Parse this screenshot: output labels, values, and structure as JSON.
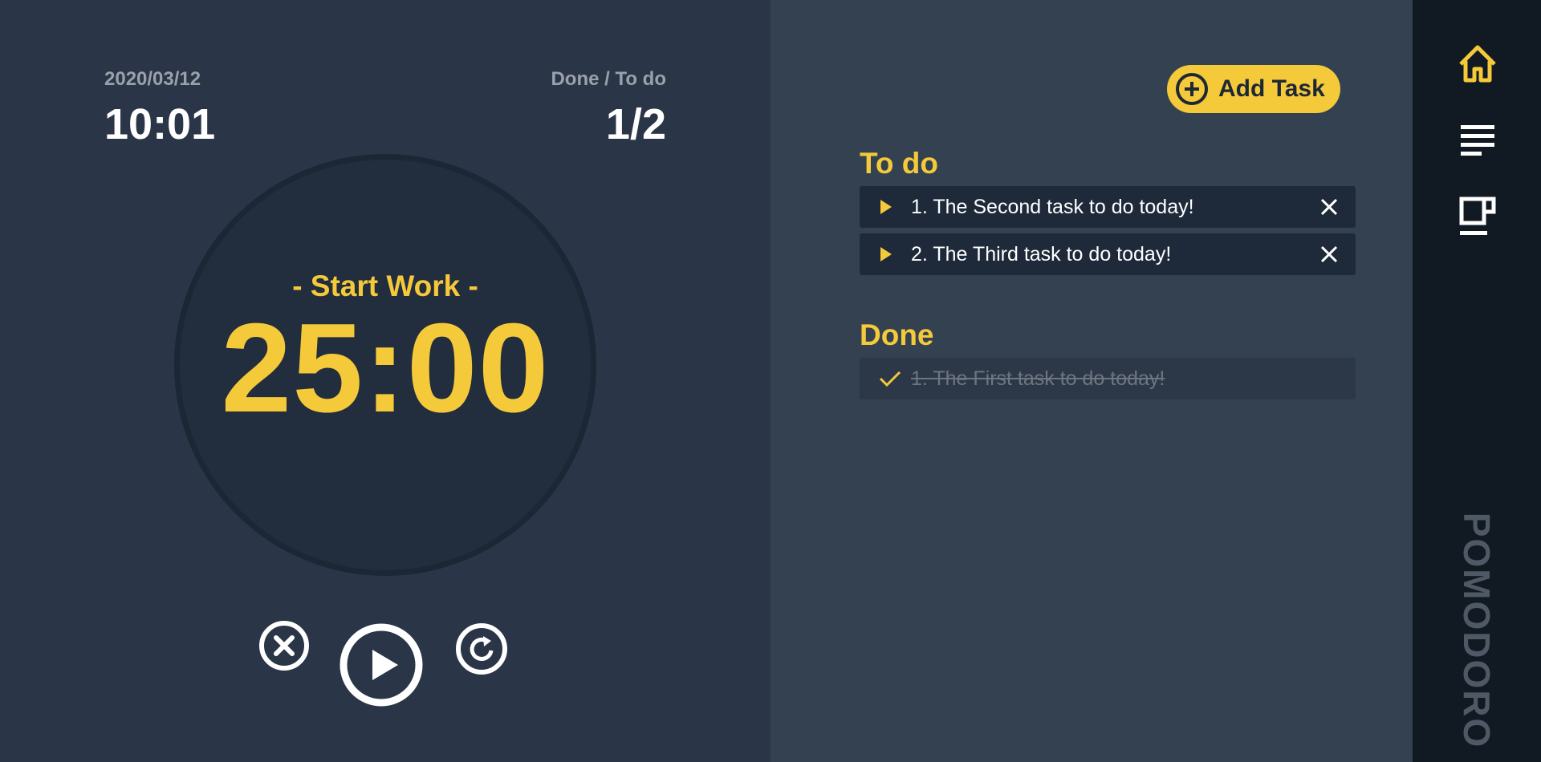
{
  "clock": {
    "date": "2020/03/12",
    "time": "10:01"
  },
  "progress": {
    "label": "Done / To do",
    "count": "1/2"
  },
  "timer": {
    "mode": "- Start Work -",
    "countdown": "25:00"
  },
  "controls": {
    "cancel_icon": "close-circle-icon",
    "play_icon": "play-circle-icon",
    "reset_icon": "refresh-circle-icon"
  },
  "tasks": {
    "add_label": "Add Task",
    "todo_title": "To do",
    "done_title": "Done",
    "todo": [
      {
        "text": "1. The Second task to do today!"
      },
      {
        "text": "2. The Third task to do today!"
      }
    ],
    "done": [
      {
        "text": "1. The First task to do today!"
      }
    ]
  },
  "sidebar": {
    "items": [
      {
        "icon": "home-icon",
        "active": true
      },
      {
        "icon": "list-icon",
        "active": false
      },
      {
        "icon": "coffee-icon",
        "active": false
      }
    ],
    "brand": "POMODORO"
  },
  "colors": {
    "accent": "#f4c93a",
    "timer_bg": "#2a3647",
    "task_bg": "#344150",
    "sidebar_bg": "#111922"
  }
}
